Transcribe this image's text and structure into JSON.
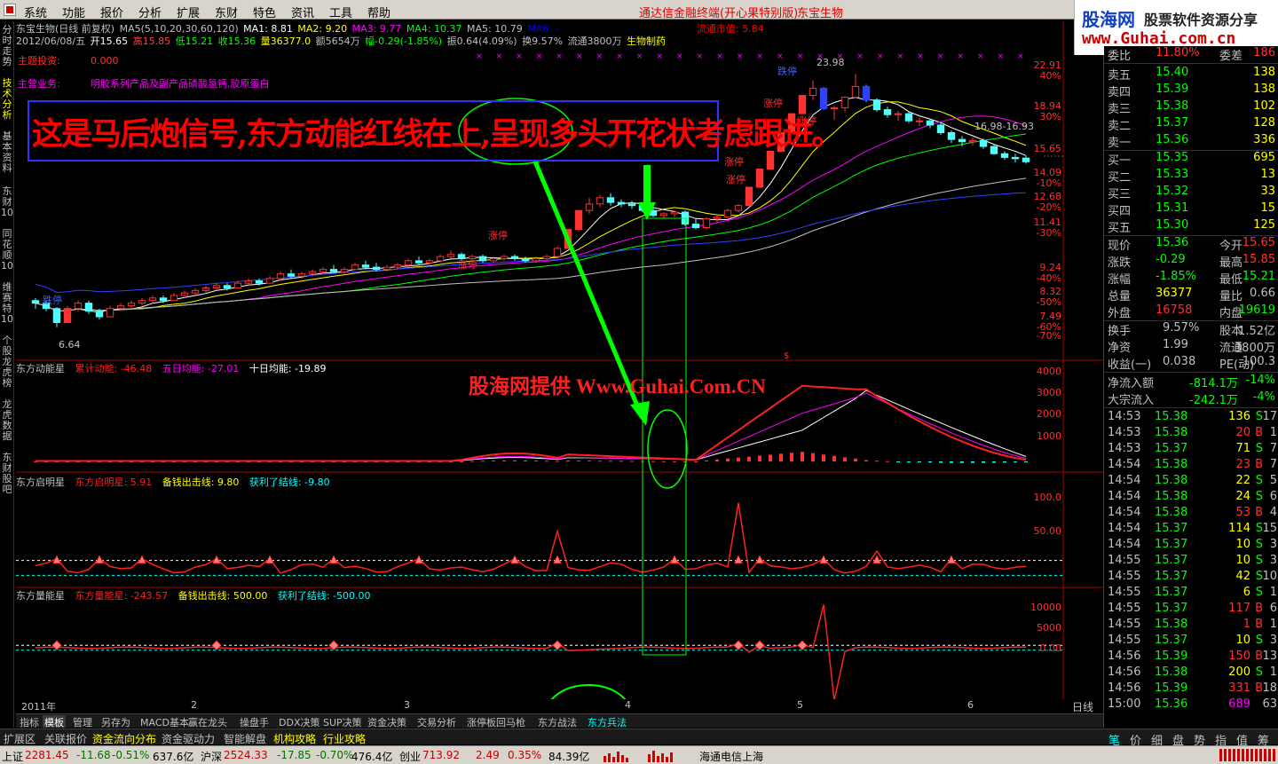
{
  "menu": {
    "items": [
      "系统",
      "功能",
      "报价",
      "分析",
      "扩展",
      "东财",
      "特色",
      "资讯",
      "工具",
      "帮助"
    ],
    "title": "通达信金融终端(开心果特别版)",
    "stock": "东宝生物"
  },
  "logo": {
    "brand": "股海网",
    "tagline": "股票软件资源分享",
    "url": "www.Guhai.com.cn"
  },
  "left_tabs": [
    "分时走势",
    "技术分析",
    "基本资料",
    "东财10",
    "同花顺10",
    "维赛特10",
    "个股龙虎榜",
    "龙虎数据",
    "东财股吧"
  ],
  "header": {
    "line1": {
      "name": "东宝生物(日线 前复权)",
      "ma_label": "MA5(5,10,20,30,60,120)",
      "ma1": "MA1: 8.81",
      "ma2": "MA2: 9.20",
      "ma3": "MA3: 9.77",
      "ma4": "MA4: 10.37",
      "ma5": "MA5: 10.79",
      "ma6": "MA6: -",
      "float_cap": "流通市值: 5.84"
    },
    "line2": {
      "date": "2012/06/08/五",
      "open": "开15.65",
      "high": "高15.85",
      "low": "低15.21",
      "close": "收15.36",
      "vol": "量36377.0",
      "amount": "额5654万",
      "change": "幅-0.29(-1.85%)",
      "amp": "振0.64(4.09%)",
      "turnover": "换9.57%",
      "float": "流通3800万",
      "industry": "生物制药"
    },
    "theme_label": "主题投资:",
    "theme_value": "0.000",
    "biz_label": "主营业务:",
    "biz_value": "明胶系列产品及副产品磷酸氢钙,胶原蛋白"
  },
  "annotation": "这是马后炮信号,东方动能红线在上,呈现多头开花状考虑跟进。",
  "watermark": "股海网提供 Www.Guhai.Com.CN",
  "price_axis": [
    {
      "label": "22.91",
      "pct": "40%"
    },
    {
      "label": "18.94",
      "pct": "30%"
    },
    {
      "label": "15.65",
      "pct": ""
    },
    {
      "label": "14.09",
      "pct": "-10%"
    },
    {
      "label": "12.68",
      "pct": "-20%"
    },
    {
      "label": "11.41",
      "pct": "-30%"
    },
    {
      "label": "9.24",
      "pct": "-40%"
    },
    {
      "label": "8.32",
      "pct": "-50%"
    },
    {
      "label": "7.49",
      "pct": "-60%"
    },
    {
      "label": "",
      "pct": "-70%"
    }
  ],
  "chart_labels": {
    "high_mark": "23.98",
    "low_mark": "6.64",
    "last_mark": "16.98-16.93",
    "limit_up": "涨停",
    "limit_down": "跌停"
  },
  "ind1": {
    "name": "东方动能星",
    "a": "累计动能: -46.48",
    "b": "五日均能: -27.01",
    "c": "十日均能: -19.89",
    "axis": [
      "4000",
      "3000",
      "2000",
      "1000"
    ]
  },
  "ind2": {
    "name": "东方启明星",
    "a": "东方启明星: 5.91",
    "b": "备钱出击线: 9.80",
    "c": "获利了结线: -9.80",
    "axis": [
      "100.0",
      "50.00"
    ]
  },
  "ind3": {
    "name": "东方量能星",
    "a": "东方量能星: -243.57",
    "b": "备钱出击线: 500.00",
    "c": "获利了结线: -500.00",
    "axis": [
      "10000",
      "5000",
      "0.00"
    ]
  },
  "dates": [
    "2011年",
    "2",
    "3",
    "4",
    "5",
    "6"
  ],
  "period": "日线",
  "bottom_tabs": [
    "指标",
    "模板",
    "管理",
    "另存为",
    "MACD基本",
    "赢在龙头",
    "操盘手",
    "DDX决策",
    "SUP决策",
    "资金决策",
    "交易分析",
    "涨停板回马枪",
    "东方战法",
    "东方兵法"
  ],
  "ext_tabs": [
    "扩展区",
    "关联报价",
    "资金流向分布",
    "资金驱动力",
    "智能解盘",
    "机构攻略",
    "行业攻略"
  ],
  "status": {
    "sh_label": "上证",
    "sh_idx": "2281.45",
    "sh_chg": "-11.68",
    "sh_pct": "-0.51%",
    "sh_amt": "637.6亿",
    "sz_label": "沪深",
    "sz_idx": "2524.33",
    "sz_chg": "-17.85",
    "sz_pct": "-0.70%",
    "sz_amt": "476.4亿",
    "cy_label": "创业",
    "cy_idx": "713.92",
    "cy_chg": "2.49",
    "cy_pct": "0.35%",
    "cy_amt": "84.39亿",
    "server": "海通电信上海"
  },
  "quote": {
    "weibi_label": "委比",
    "weibi": "11.80%",
    "weicha_label": "委差",
    "weicha": "186",
    "asks": [
      [
        "卖五",
        "15.40",
        "138"
      ],
      [
        "卖四",
        "15.39",
        "138"
      ],
      [
        "卖三",
        "15.38",
        "102"
      ],
      [
        "卖二",
        "15.37",
        "128"
      ],
      [
        "卖一",
        "15.36",
        "336"
      ]
    ],
    "bids": [
      [
        "买一",
        "15.35",
        "695"
      ],
      [
        "买二",
        "15.33",
        "13"
      ],
      [
        "买三",
        "15.32",
        "33"
      ],
      [
        "买四",
        "15.31",
        "15"
      ],
      [
        "买五",
        "15.30",
        "125"
      ]
    ],
    "stats": [
      [
        "现价",
        "15.36",
        "今开",
        "15.65"
      ],
      [
        "涨跌",
        "-0.29",
        "最高",
        "15.85"
      ],
      [
        "涨幅",
        "-1.85%",
        "最低",
        "15.21"
      ],
      [
        "总量",
        "36377",
        "量比",
        "0.66"
      ],
      [
        "外盘",
        "16758",
        "内盘",
        "19619"
      ]
    ],
    "stats2": [
      [
        "换手",
        "9.57%",
        "股本",
        "1.52亿"
      ],
      [
        "净资",
        "1.99",
        "流通",
        "3800万"
      ],
      [
        "收益(一)",
        "0.038",
        "PE(动)",
        "100.3"
      ]
    ],
    "flow": [
      [
        "净流入额",
        "-814.1万",
        "-14%"
      ],
      [
        "大宗流入",
        "-242.1万",
        "-4%"
      ]
    ],
    "ticks": [
      [
        "14:53",
        "15.38",
        "136",
        "S",
        "17"
      ],
      [
        "14:53",
        "15.38",
        "20",
        "B",
        "1"
      ],
      [
        "14:53",
        "15.37",
        "71",
        "S",
        "7"
      ],
      [
        "14:54",
        "15.38",
        "23",
        "B",
        "7"
      ],
      [
        "14:54",
        "15.38",
        "22",
        "S",
        "5"
      ],
      [
        "14:54",
        "15.38",
        "24",
        "S",
        "6"
      ],
      [
        "14:54",
        "15.38",
        "53",
        "B",
        "4"
      ],
      [
        "14:54",
        "15.37",
        "114",
        "S",
        "15"
      ],
      [
        "14:54",
        "15.37",
        "10",
        "S",
        "3"
      ],
      [
        "14:55",
        "15.37",
        "10",
        "S",
        "3"
      ],
      [
        "14:55",
        "15.37",
        "42",
        "S",
        "10"
      ],
      [
        "14:55",
        "15.37",
        "6",
        "S",
        "1"
      ],
      [
        "14:55",
        "15.37",
        "117",
        "B",
        "6"
      ],
      [
        "14:55",
        "15.38",
        "1",
        "B",
        "1"
      ],
      [
        "14:55",
        "15.37",
        "10",
        "S",
        "3"
      ],
      [
        "14:56",
        "15.39",
        "150",
        "B",
        "13"
      ],
      [
        "14:56",
        "15.38",
        "200",
        "S",
        "1"
      ],
      [
        "14:56",
        "15.39",
        "331",
        "B",
        "18"
      ],
      [
        "15:00",
        "15.36",
        "689",
        "",
        "63"
      ]
    ],
    "foot_tabs": [
      "笔",
      "价",
      "细",
      "盘",
      "势",
      "指",
      "值",
      "筹"
    ]
  },
  "chart_data": {
    "type": "candlestick",
    "period": "daily",
    "candles": [
      [
        7.6,
        7.7,
        7.3,
        7.5
      ],
      [
        7.5,
        7.6,
        7.2,
        7.3
      ],
      [
        7.3,
        7.35,
        6.64,
        6.8
      ],
      [
        6.8,
        7.4,
        6.8,
        7.3
      ],
      [
        7.3,
        7.6,
        7.2,
        7.5
      ],
      [
        7.5,
        7.6,
        7.1,
        7.2
      ],
      [
        7.2,
        7.3,
        6.9,
        7.0
      ],
      [
        7.0,
        7.4,
        7.0,
        7.3
      ],
      [
        7.3,
        7.5,
        7.2,
        7.4
      ],
      [
        7.4,
        7.6,
        7.3,
        7.5
      ],
      [
        7.5,
        7.7,
        7.4,
        7.6
      ],
      [
        7.6,
        7.8,
        7.5,
        7.7
      ],
      [
        7.7,
        7.8,
        7.5,
        7.6
      ],
      [
        7.6,
        7.9,
        7.6,
        7.8
      ],
      [
        7.8,
        8.0,
        7.7,
        7.9
      ],
      [
        7.9,
        8.1,
        7.8,
        8.0
      ],
      [
        8.0,
        8.2,
        7.9,
        8.1
      ],
      [
        8.1,
        8.3,
        8.0,
        8.2
      ],
      [
        8.2,
        8.3,
        8.0,
        8.1
      ],
      [
        8.1,
        8.4,
        8.1,
        8.3
      ],
      [
        8.3,
        8.5,
        8.2,
        8.4
      ],
      [
        8.4,
        8.5,
        8.2,
        8.3
      ],
      [
        8.3,
        8.6,
        8.3,
        8.5
      ],
      [
        8.5,
        8.8,
        8.4,
        8.7
      ],
      [
        8.7,
        8.9,
        8.5,
        8.6
      ],
      [
        8.6,
        8.8,
        8.5,
        8.7
      ],
      [
        8.7,
        8.9,
        8.6,
        8.8
      ],
      [
        8.8,
        9.0,
        8.7,
        8.9
      ],
      [
        8.9,
        9.1,
        8.8,
        8.8
      ],
      [
        8.8,
        9.0,
        8.7,
        8.9
      ],
      [
        8.9,
        9.2,
        8.9,
        9.1
      ],
      [
        9.1,
        9.3,
        8.9,
        9.0
      ],
      [
        9.0,
        9.2,
        8.8,
        8.9
      ],
      [
        8.9,
        9.1,
        8.8,
        9.0
      ],
      [
        9.0,
        9.2,
        8.9,
        9.1
      ],
      [
        9.1,
        9.4,
        9.0,
        9.3
      ],
      [
        9.3,
        9.5,
        9.1,
        9.2
      ],
      [
        9.2,
        9.4,
        9.1,
        9.3
      ],
      [
        9.3,
        9.6,
        9.2,
        9.5
      ],
      [
        9.5,
        9.8,
        9.4,
        9.6
      ],
      [
        9.6,
        9.7,
        9.3,
        9.4
      ],
      [
        9.4,
        9.6,
        9.3,
        9.5
      ],
      [
        9.5,
        9.6,
        9.2,
        9.3
      ],
      [
        9.3,
        9.5,
        9.2,
        9.4
      ],
      [
        9.4,
        9.6,
        9.3,
        9.5
      ],
      [
        9.5,
        9.6,
        9.3,
        9.4
      ],
      [
        9.4,
        9.5,
        9.2,
        9.3
      ],
      [
        9.3,
        9.5,
        9.2,
        9.4
      ],
      [
        9.4,
        9.6,
        9.3,
        9.5
      ],
      [
        9.5,
        10.0,
        9.4,
        9.9
      ],
      [
        9.9,
        10.9,
        9.9,
        10.9
      ],
      [
        10.9,
        12.0,
        10.8,
        12.0
      ],
      [
        12.0,
        12.8,
        11.8,
        12.4
      ],
      [
        12.4,
        13.0,
        12.2,
        12.8
      ],
      [
        12.8,
        13.1,
        12.3,
        12.5
      ],
      [
        12.5,
        12.7,
        12.2,
        12.4
      ],
      [
        12.4,
        12.6,
        12.1,
        12.3
      ],
      [
        12.3,
        12.5,
        11.9,
        12.0
      ],
      [
        12.0,
        12.2,
        11.6,
        11.7
      ],
      [
        11.7,
        11.9,
        11.5,
        11.8
      ],
      [
        11.8,
        12.0,
        11.6,
        11.9
      ],
      [
        11.9,
        12.0,
        11.1,
        11.2
      ],
      [
        11.2,
        11.5,
        10.9,
        11.0
      ],
      [
        11.0,
        11.6,
        10.9,
        11.5
      ],
      [
        11.5,
        11.8,
        11.3,
        11.6
      ],
      [
        11.6,
        12.1,
        11.5,
        12.0
      ],
      [
        12.0,
        12.4,
        11.9,
        12.3
      ],
      [
        12.3,
        13.5,
        12.3,
        13.5
      ],
      [
        13.5,
        14.8,
        13.5,
        14.8
      ],
      [
        14.8,
        16.2,
        14.8,
        16.2
      ],
      [
        16.2,
        17.8,
        16.2,
        17.8
      ],
      [
        17.8,
        19.6,
        17.8,
        19.6
      ],
      [
        19.6,
        21.5,
        19.6,
        21.5
      ],
      [
        21.5,
        23.2,
        21.0,
        22.3
      ],
      [
        22.3,
        22.4,
        20.0,
        20.1
      ],
      [
        20.1,
        20.4,
        19.0,
        20.2
      ],
      [
        20.2,
        21.4,
        19.8,
        21.3
      ],
      [
        21.3,
        23.98,
        21.2,
        22.5
      ],
      [
        22.5,
        22.7,
        20.8,
        21.0
      ],
      [
        21.0,
        21.2,
        19.8,
        20.0
      ],
      [
        20.0,
        20.3,
        19.2,
        19.5
      ],
      [
        19.5,
        19.9,
        18.9,
        19.6
      ],
      [
        19.6,
        19.8,
        18.7,
        18.9
      ],
      [
        18.9,
        19.2,
        18.4,
        18.9
      ],
      [
        18.9,
        19.1,
        18.2,
        18.5
      ],
      [
        18.5,
        18.7,
        17.6,
        17.8
      ],
      [
        17.8,
        18.0,
        16.9,
        17.2
      ],
      [
        17.2,
        17.5,
        16.6,
        17.0
      ],
      [
        17.0,
        17.4,
        16.7,
        17.1
      ],
      [
        17.1,
        17.3,
        16.4,
        16.6
      ],
      [
        16.6,
        16.8,
        15.9,
        16.0
      ],
      [
        16.0,
        16.2,
        15.5,
        15.7
      ],
      [
        15.7,
        16.0,
        15.3,
        15.6
      ],
      [
        15.65,
        15.85,
        15.21,
        15.36
      ]
    ],
    "ylim": [
      6.2,
      25.0
    ],
    "log_scale": true
  }
}
